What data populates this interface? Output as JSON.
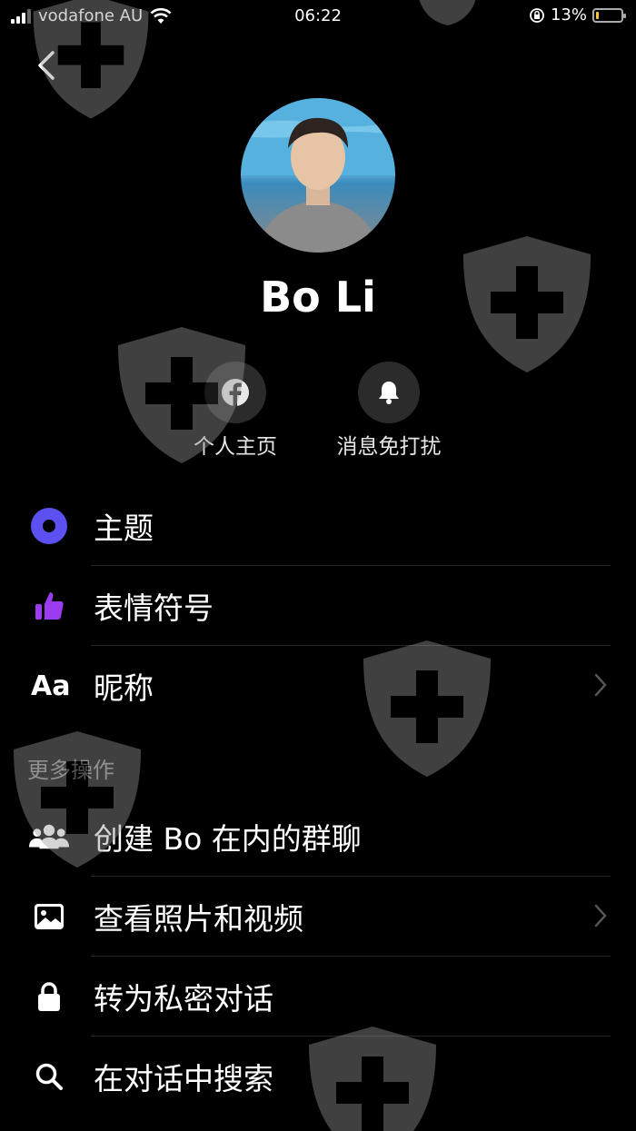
{
  "status_bar": {
    "carrier": "vodafone AU",
    "time": "06:22",
    "battery": "13%",
    "battery_level": 0.13
  },
  "profile": {
    "name": "Bo Li"
  },
  "quick_actions": [
    {
      "label": "个人主页",
      "icon": "facebook-icon"
    },
    {
      "label": "消息免打扰",
      "icon": "bell-icon"
    }
  ],
  "menu": {
    "theme": "主题",
    "emoji": "表情符号",
    "nickname": "昵称",
    "nickname_icon_text": "Aa"
  },
  "more_actions": {
    "title": "更多操作",
    "create_group": "创建 Bo 在内的群聊",
    "view_media": "查看照片和视频",
    "secret": "转为私密对话",
    "search": "在对话中搜索"
  },
  "colors": {
    "accent_theme": "#5c50f0",
    "accent_emoji": "#9b3cf0",
    "background": "#000000"
  }
}
